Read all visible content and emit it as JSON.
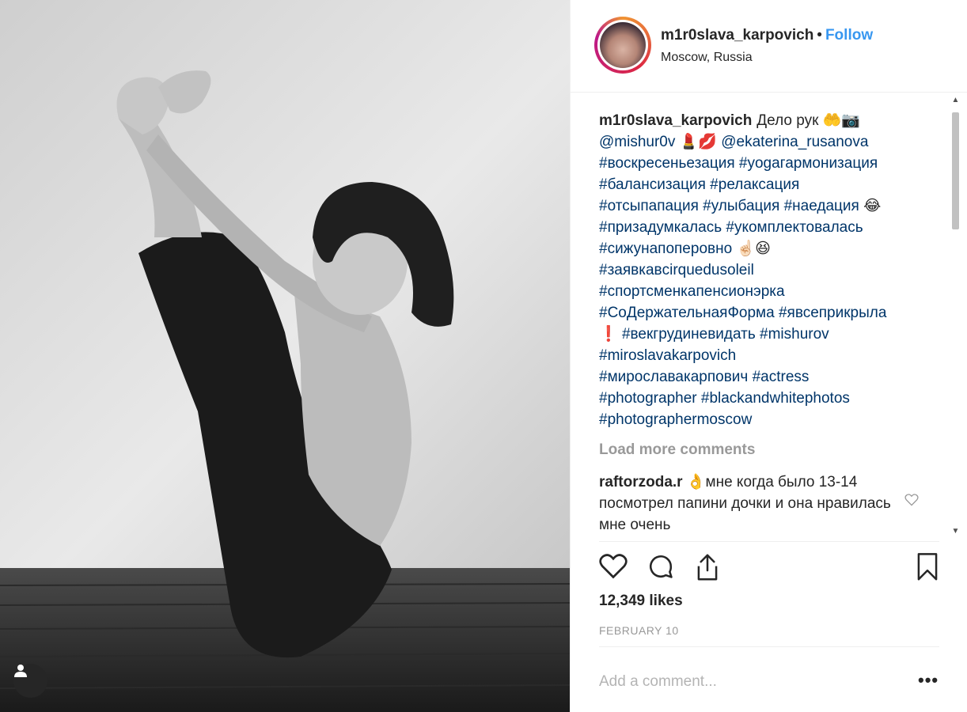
{
  "post": {
    "author": "m1r0slava_karpovich",
    "separator": "•",
    "follow_label": "Follow",
    "location": "Moscow, Russia"
  },
  "caption": {
    "username": "m1r0slava_karpovich",
    "text": "Дело рук 🤲📷",
    "mention1": "@mishur0v",
    "emoji1": "💄💋",
    "mention2": "@ekaterina_rusanova",
    "line3": "#воскресеньезация #yogaгармонизация",
    "line4": "#балансизация #релаксация",
    "line5": "#отсыпапация #улыбация #наедация",
    "emoji5": "😂",
    "line6": "#призадумкалась #укомплектовалась",
    "line7": "#сижунапоперовно",
    "emoji7": "☝🏻😆",
    "line8": "#заявкавcirquedusoleil",
    "line9": "#спортсменкапенсионэрка",
    "line10": "#СоДержательнаяФорма #явсеприкрыла",
    "emoji11": "❗",
    "line11": "#векгрудиневидать #mishurov",
    "line12": "#miroslavakarpovich",
    "line13": "#мирославакарпович #actress",
    "line14": "#photographer #blackandwhitephotos",
    "line15": "#photographermoscow"
  },
  "load_more_label": "Load more comments",
  "comments": [
    {
      "username": "raftorzoda.r",
      "emoji": "👌",
      "text": "мне когда было 13-14 посмотрел папини дочки и она нравилась мне очень"
    }
  ],
  "likes_text": "12,349 likes",
  "date_text": "FEBRUARY 10",
  "add_comment": {
    "placeholder": "Add a comment...",
    "more_label": "•••"
  },
  "icons": {
    "like": "heart-icon",
    "comment": "speech-bubble-icon",
    "share": "share-icon",
    "save": "bookmark-icon",
    "user_tag": "user-icon"
  }
}
